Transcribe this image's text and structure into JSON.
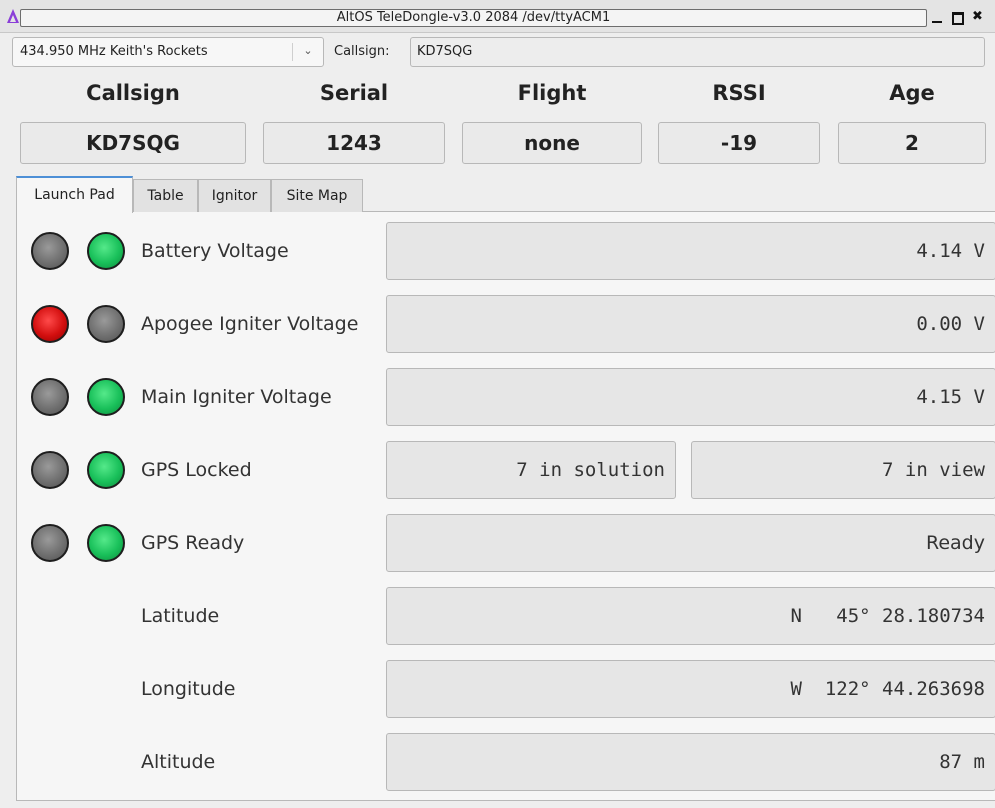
{
  "window": {
    "title": "AltOS TeleDongle-v3.0 2084 /dev/ttyACM1"
  },
  "toolbar": {
    "frequency": "434.950 MHz Keith's Rockets",
    "callsign_label": "Callsign:",
    "callsign_value": "KD7SQG"
  },
  "summary": {
    "headers": [
      "Callsign",
      "Serial",
      "Flight",
      "RSSI",
      "Age"
    ],
    "values": [
      "KD7SQG",
      "1243",
      "none",
      "-19",
      "2"
    ]
  },
  "tabs": [
    {
      "label": "Launch Pad",
      "active": true
    },
    {
      "label": "Table",
      "active": false
    },
    {
      "label": "Ignitor",
      "active": false
    },
    {
      "label": "Site Map",
      "active": false
    }
  ],
  "rows": [
    {
      "label": "Battery Voltage",
      "led1": "gray",
      "led2": "green",
      "value": "4.14 V"
    },
    {
      "label": "Apogee Igniter Voltage",
      "led1": "red",
      "led2": "gray",
      "value": "0.00 V"
    },
    {
      "label": "Main Igniter Voltage",
      "led1": "gray",
      "led2": "green",
      "value": "4.15 V"
    },
    {
      "label": "GPS Locked",
      "led1": "gray",
      "led2": "green",
      "value_a": "7 in solution",
      "value_b": "7 in view"
    },
    {
      "label": "GPS Ready",
      "led1": "gray",
      "led2": "green",
      "value": "Ready"
    },
    {
      "label": "Latitude",
      "value": "N   45° 28.180734"
    },
    {
      "label": "Longitude",
      "value": "W  122° 44.263698"
    },
    {
      "label": "Altitude",
      "value": "87 m"
    }
  ],
  "colors": {
    "led_gray": "#707070",
    "led_green": "#19c05a",
    "led_red": "#d30f0f",
    "tab_accent": "#4d8fd6"
  }
}
